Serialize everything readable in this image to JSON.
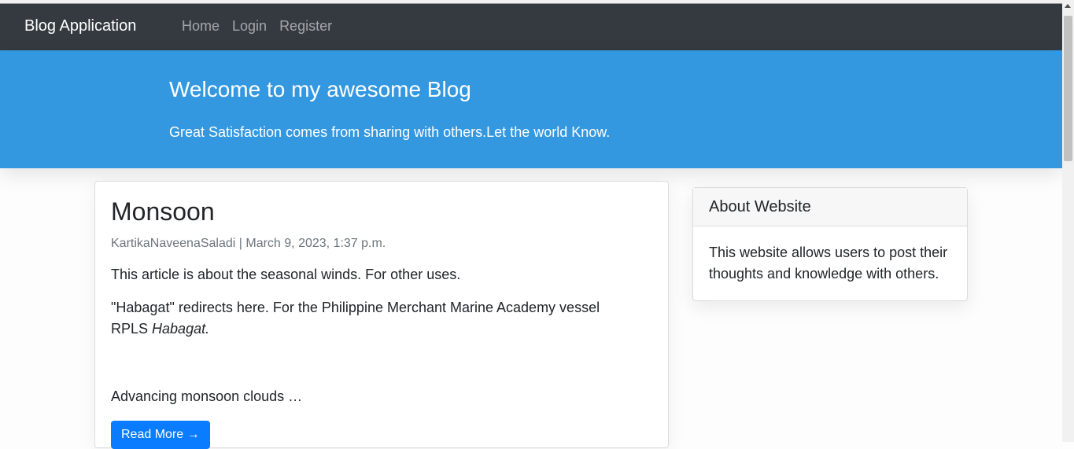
{
  "navbar": {
    "brand": "Blog Application",
    "links": [
      "Home",
      "Login",
      "Register"
    ]
  },
  "masthead": {
    "title": "Welcome to my awesome Blog",
    "subtitle": "Great Satisfaction comes from sharing with others.Let the world Know."
  },
  "post": {
    "title": "Monsoon",
    "author": "KartikaNaveenaSaladi",
    "date": "March 9, 2023, 1:37 p.m.",
    "para1": "This article is about the seasonal winds. For other uses.",
    "para2_text": "\"Habagat\" redirects here. For the Philippine Merchant Marine Academy vessel RPLS ",
    "para2_italic": "Habagat.",
    "para3": "Advancing monsoon clouds …",
    "button_label": "Read More →"
  },
  "sidebar": {
    "header": "About Website",
    "body": "This website allows users to post their thoughts and knowledge with others."
  }
}
